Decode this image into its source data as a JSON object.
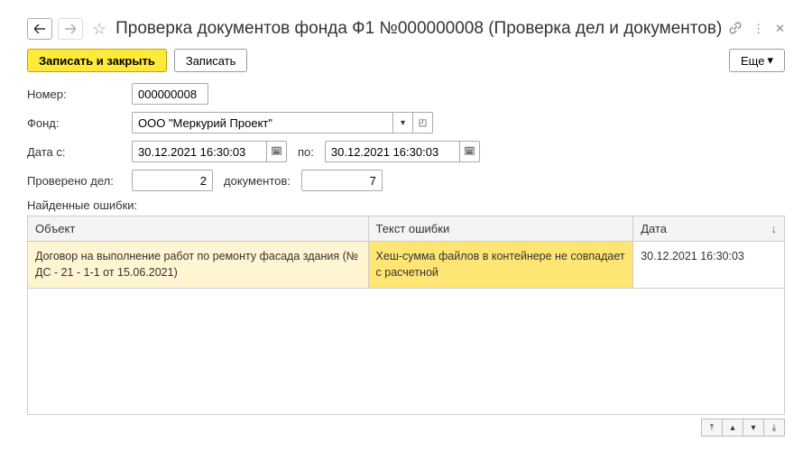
{
  "header": {
    "title": "Проверка документов фонда Ф1 №000000008 (Проверка дел и документов)"
  },
  "toolbar": {
    "save_close": "Записать и закрыть",
    "save": "Записать",
    "more": "Еще"
  },
  "form": {
    "number_label": "Номер:",
    "number_value": "000000008",
    "fund_label": "Фонд:",
    "fund_value": "ООО \"Меркурий Проект\"",
    "date_from_label": "Дата с:",
    "date_from_value": "30.12.2021 16:30:03",
    "date_to_label": "по:",
    "date_to_value": "30.12.2021 16:30:03",
    "checked_cases_label": "Проверено дел:",
    "checked_cases_value": "2",
    "docs_label": "документов:",
    "docs_value": "7"
  },
  "errors": {
    "section_label": "Найденные ошибки:",
    "columns": {
      "object": "Объект",
      "error_text": "Текст ошибки",
      "date": "Дата"
    },
    "rows": [
      {
        "object": "Договор  на  выполнение работ по ремонту фасада здания (№ ДС - 21 - 1-1 от 15.06.2021)",
        "error_text": "Хеш-сумма файлов в контейнере не совпадает с расчетной",
        "date": "30.12.2021 16:30:03"
      }
    ]
  }
}
